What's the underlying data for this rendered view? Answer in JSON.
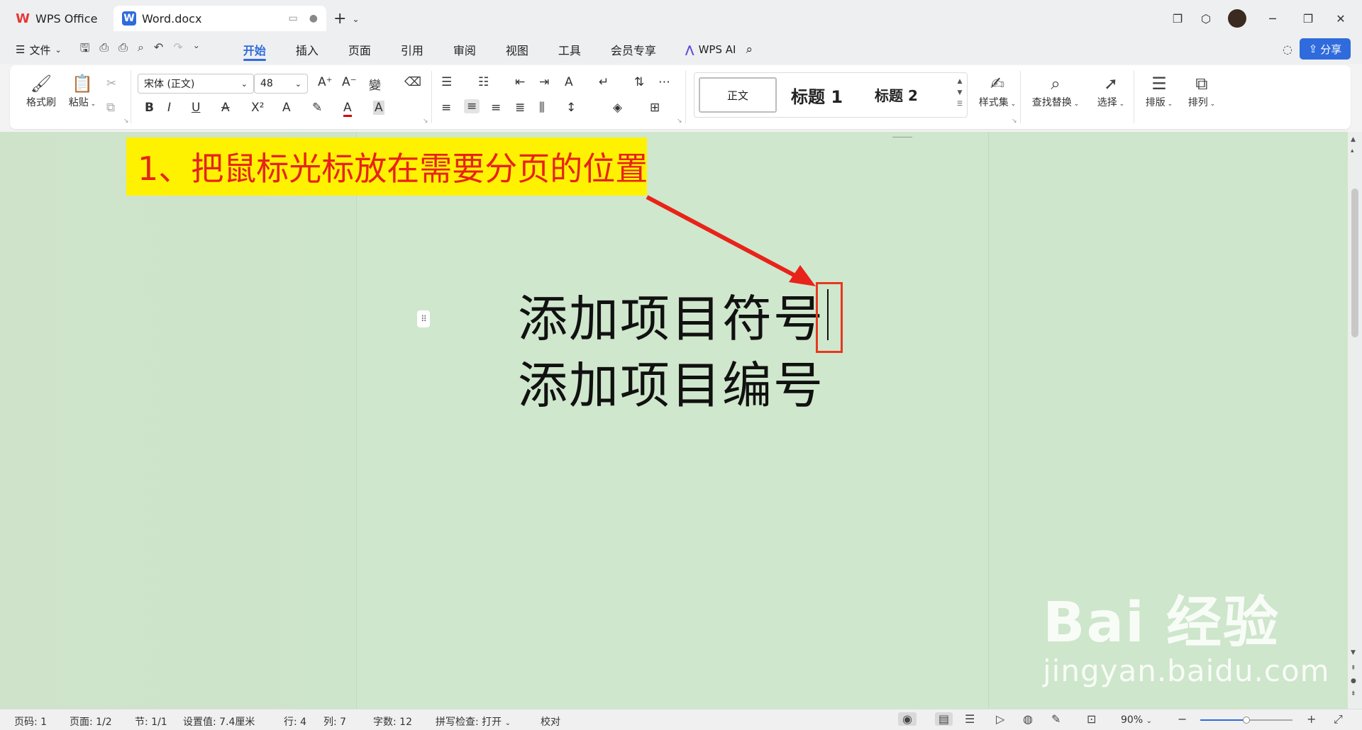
{
  "tabs": {
    "home": "WPS Office",
    "document": "Word.docx"
  },
  "menu": {
    "file": "文件",
    "items": [
      "开始",
      "插入",
      "页面",
      "引用",
      "审阅",
      "视图",
      "工具",
      "会员专享"
    ],
    "active": "开始",
    "wps_ai": "WPS AI",
    "share": "分享"
  },
  "ribbon": {
    "format_painter": "格式刷",
    "paste": "粘贴",
    "font_name": "宋体 (正文)",
    "font_size": "48",
    "styles": {
      "normal": "正文",
      "heading1": "标题 1",
      "heading2": "标题 2",
      "style_set": "样式集"
    },
    "find_replace": "查找替换",
    "select": "选择",
    "layout": "排版",
    "arrange": "排列"
  },
  "document": {
    "lines": [
      "添加项目符号",
      "添加项目编号"
    ]
  },
  "annotation": {
    "text": "1、把鼠标光标放在需要分页的位置",
    "accent_color": "#e8231a",
    "background_color": "#fff200"
  },
  "watermark": {
    "brand": "Bai  经验",
    "url": "jingyan.baidu.com"
  },
  "status": {
    "page_code": "页码: 1",
    "pages": "页面: 1/2",
    "section": "节: 1/1",
    "setting": "设置值: 7.4厘米",
    "row": "行: 4",
    "column": "列: 7",
    "word_count": "字数: 12",
    "spell_check": "拼写检查: 打开",
    "proofread": "校对",
    "zoom": "90%",
    "zoom_fraction": 0.5
  },
  "colors": {
    "accent": "#2f6bdc",
    "doc_background": "#cee6cb"
  }
}
